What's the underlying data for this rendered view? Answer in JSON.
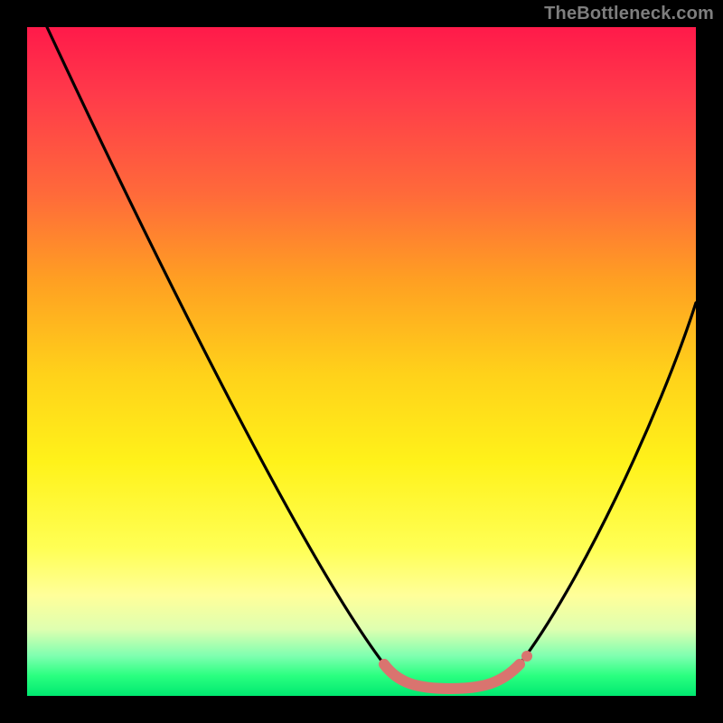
{
  "attribution": "TheBottleneck.com",
  "chart_data": {
    "type": "line",
    "title": "",
    "xlabel": "",
    "ylabel": "",
    "xlim": [
      0,
      100
    ],
    "ylim": [
      0,
      100
    ],
    "colors": {
      "curve": "#000000",
      "flat_segment": "#d9746f",
      "background_top": "#ff1a4a",
      "background_bottom": "#00e870"
    },
    "series": [
      {
        "name": "left-branch",
        "x": [
          3,
          15,
          27,
          39,
          50,
          55
        ],
        "y": [
          100,
          78,
          54,
          30,
          8,
          3
        ],
        "stroke": "#000000"
      },
      {
        "name": "right-branch",
        "x": [
          74,
          80,
          88,
          96,
          100
        ],
        "y": [
          3,
          10,
          28,
          48,
          58
        ],
        "stroke": "#000000"
      },
      {
        "name": "flat-minimum",
        "x": [
          55,
          58,
          62,
          66,
          70,
          74
        ],
        "y": [
          3,
          1,
          0,
          0,
          1,
          3
        ],
        "stroke": "#d9746f"
      }
    ],
    "annotations": []
  }
}
